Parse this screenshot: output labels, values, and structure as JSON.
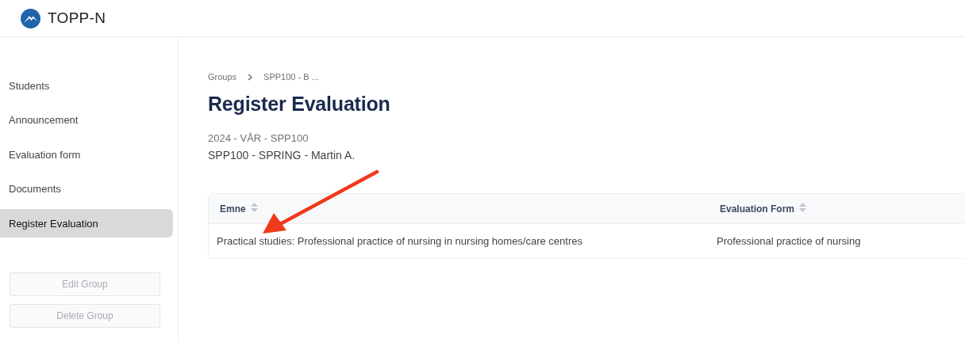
{
  "header": {
    "app_name": "TOPP-N"
  },
  "sidebar": {
    "items": [
      {
        "label": "Students",
        "selected": false
      },
      {
        "label": "Announcement",
        "selected": false
      },
      {
        "label": "Evaluation form",
        "selected": false
      },
      {
        "label": "Documents",
        "selected": false
      },
      {
        "label": "Register Evaluation",
        "selected": true
      }
    ],
    "buttons": [
      {
        "label": "Edit Group",
        "disabled": true
      },
      {
        "label": "Delete Group",
        "disabled": true
      }
    ]
  },
  "breadcrumb": [
    "Groups",
    "SPP100 - B ..."
  ],
  "title": "Register Evaluation",
  "subtitle_lines": [
    "2024 - VÅR - SPP100",
    "SPP100 - SPRING - Martin A."
  ],
  "table": {
    "columns": [
      "Emne",
      "Evaluation Form"
    ],
    "rows": [
      [
        "Practical studies: Professional practice of nursing in nursing homes/care centres",
        "Professional practice of nursing"
      ]
    ]
  },
  "annotation": {
    "kind": "arrow"
  }
}
